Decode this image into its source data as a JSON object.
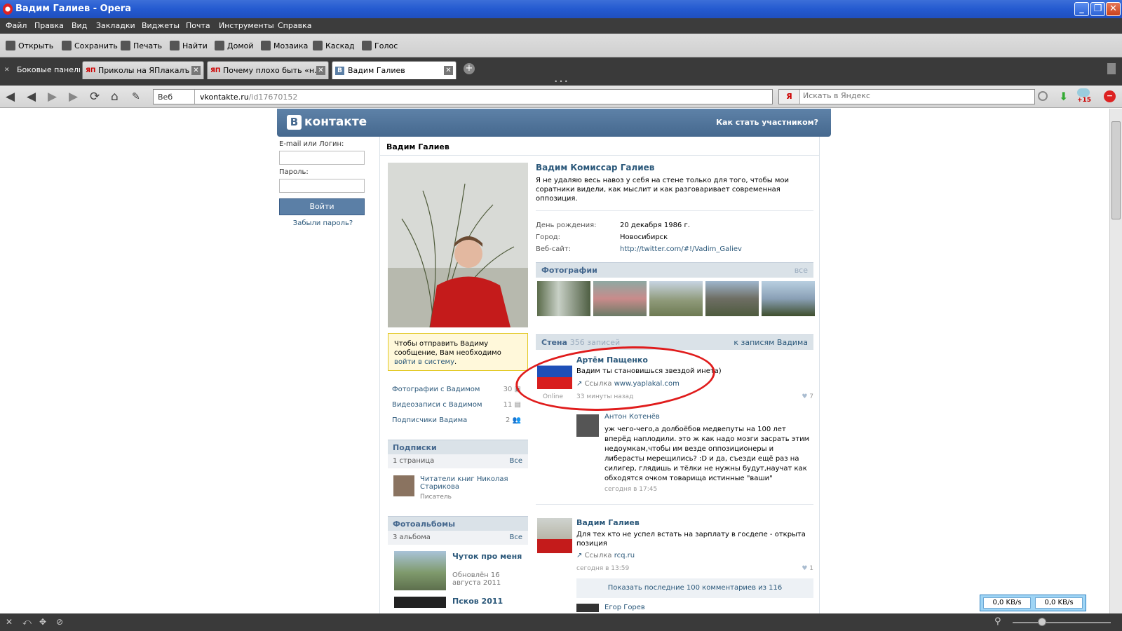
{
  "window": {
    "title": "Вадим Галиев - Opera"
  },
  "menu": [
    "Файл",
    "Правка",
    "Вид",
    "Закладки",
    "Виджеты",
    "Почта",
    "Инструменты",
    "Справка"
  ],
  "toolbar": [
    "Открыть",
    "Сохранить",
    "Печать",
    "Найти",
    "Домой",
    "Мозаика",
    "Каскад",
    "Голос"
  ],
  "tabs": {
    "panels": "Боковые панели",
    "items": [
      {
        "label": "Приколы на ЯПлакалъ",
        "icon": "ЯП"
      },
      {
        "label": "Почему плохо быть «н…",
        "icon": "ЯП"
      },
      {
        "label": "Вадим Галиев",
        "icon": "В"
      }
    ]
  },
  "address": {
    "scope": "Веб",
    "domain": "vkontakte.ru",
    "path": "/id17670152"
  },
  "search": {
    "engine": "Я",
    "placeholder": "Искать в Яндекс"
  },
  "toolbar_badge": "+15",
  "vk": {
    "logo_letter": "В",
    "logo": "контакте",
    "join": "Как стать участником?",
    "login": {
      "email_label": "E-mail или Логин:",
      "password_label": "Пароль:",
      "button": "Войти",
      "forgot": "Забыли пароль?"
    },
    "page_title": "Вадим Галиев",
    "profile": {
      "name": "Вадим Комиссар Галиев",
      "status": "Я не удаляю весь навоз у себя на стене только для того, чтобы мои соратники видели, как мыслит и как разговаривает современная оппозиция.",
      "info": [
        {
          "k": "День рождения:",
          "v": "20 декабря 1986 г."
        },
        {
          "k": "Город:",
          "v": "Новосибирск"
        },
        {
          "k": "Веб-сайт:",
          "v": "http://twitter.com/#!/Vadim_Galiev"
        }
      ]
    },
    "message_box": {
      "text": "Чтобы отправить Вадиму сообщение, Вам необходимо ",
      "link": "войти в систему",
      "end": "."
    },
    "side_links": [
      {
        "label": "Фотографии с Вадимом",
        "count": "30"
      },
      {
        "label": "Видеозаписи с Вадимом",
        "count": "11"
      },
      {
        "label": "Подписчики Вадима",
        "count": "2"
      }
    ],
    "subscriptions": {
      "title": "Подписки",
      "sub": "1 страница",
      "all": "Все",
      "item": "Читатели книг Николая Старикова",
      "item_sub": "Писатель"
    },
    "albums": {
      "title": "Фотоальбомы",
      "sub": "3 альбома",
      "all": "Все",
      "item": "Чуток про меня",
      "item_sub": "Обновлён 16 августа 2011",
      "item2": "Псков 2011"
    },
    "photos": {
      "title": "Фотографии",
      "all": "все"
    },
    "wall": {
      "title": "Стена",
      "count": "356 записей",
      "link": "к записям Вадима"
    },
    "posts": [
      {
        "author": "Артём Пащенко",
        "text": "Вадим ты становишься звездой инета)",
        "link_label": "Ссылка",
        "link": "www.yaplakal.com",
        "time": "33 минуты назад",
        "likes": "7",
        "online": "Online"
      },
      {
        "author": "Вадим Галиев",
        "text": "Для тех кто не успел встать на зарплату в госдепе - открыта позиция",
        "link_label": "Ссылка",
        "link": "rcq.ru",
        "time": "сегодня в 13:59",
        "likes": "1"
      }
    ],
    "comment": {
      "author": "Антон Котенёв",
      "text": "уж чего-чего,а долбоёбов медвепуты на 100 лет вперёд наплодили. это ж как надо мозги засрать этим недоумкам,чтобы им везде оппозиционеры и либерасты мерещились? :D и да, съезди ещё раз на силигер, глядишь и тёлки не нужны будут,научат как обходятся очком товарища истинные \"ваши\"",
      "time": "сегодня в 17:45"
    },
    "show_more": "Показать последние 100 комментариев из 116",
    "next_author": "Егор Горев"
  },
  "net": {
    "down": "0,0 KB/s",
    "up": "0,0 KB/s"
  }
}
